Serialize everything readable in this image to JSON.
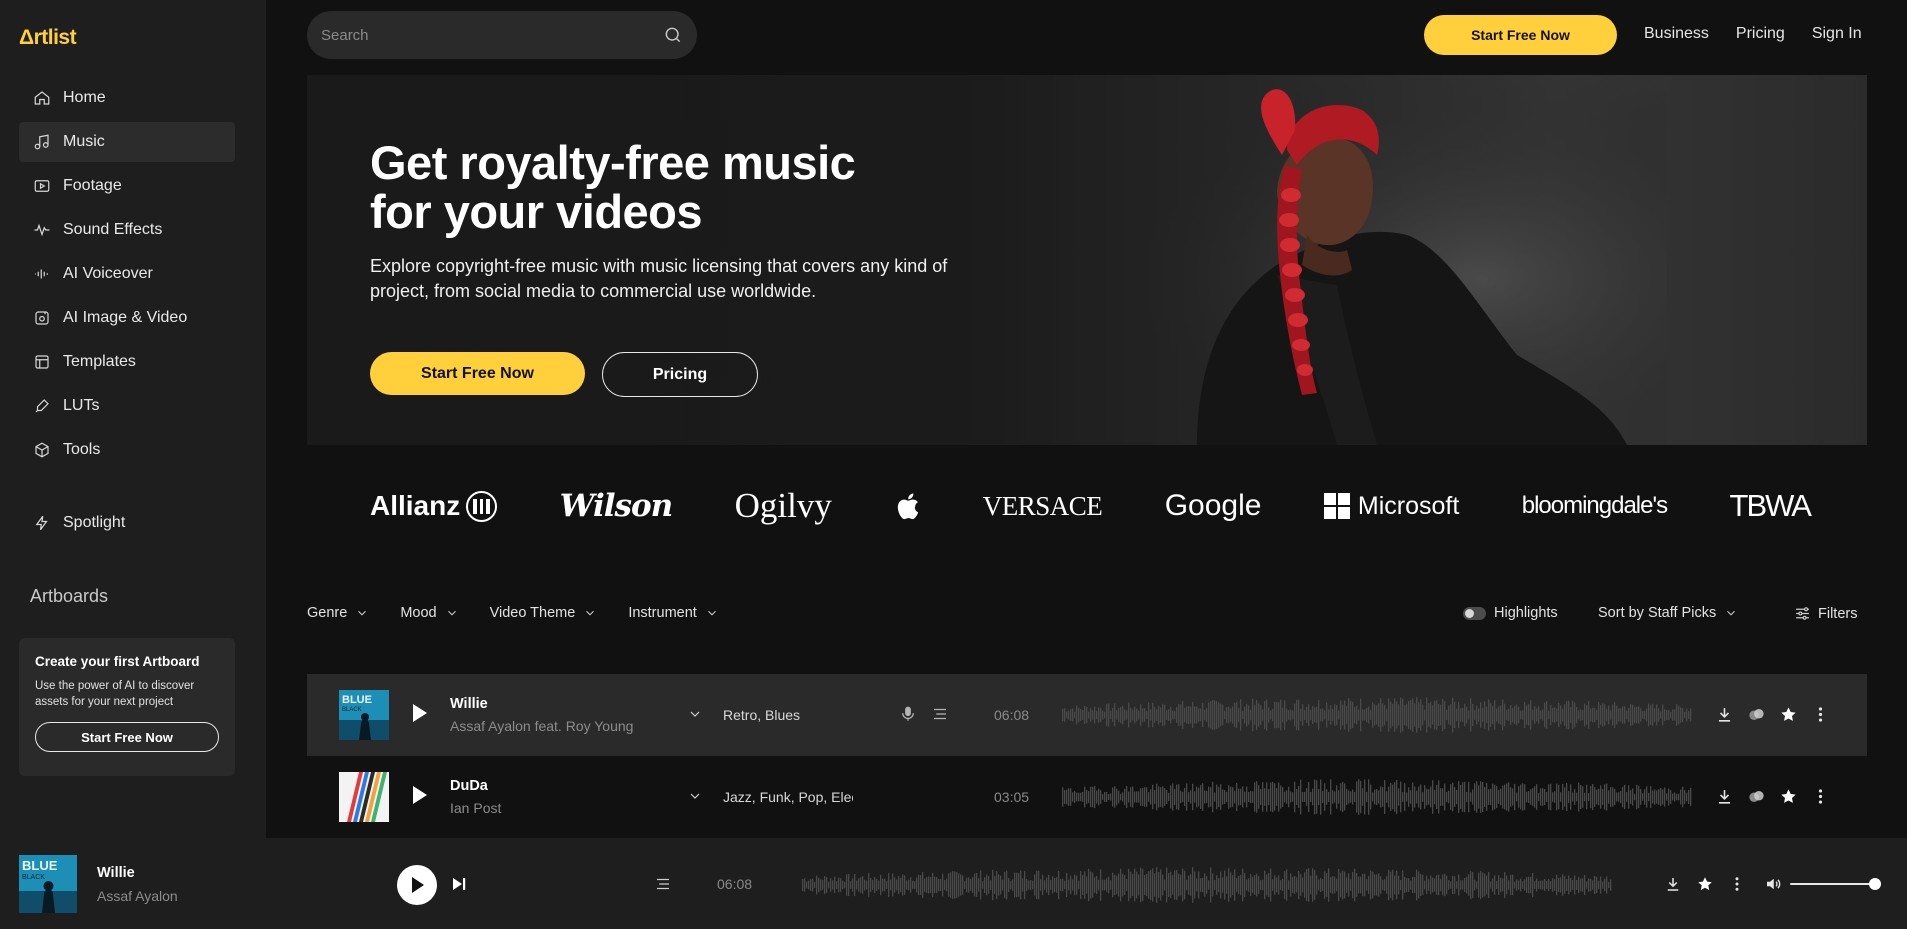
{
  "brand": {
    "logo": "Δrtlist",
    "accent": "#ffd03c"
  },
  "sidebar": {
    "items": [
      {
        "label": "Home",
        "icon": "home-icon"
      },
      {
        "label": "Music",
        "icon": "music-note-icon",
        "active": true
      },
      {
        "label": "Footage",
        "icon": "video-icon"
      },
      {
        "label": "Sound Effects",
        "icon": "waveform-icon"
      },
      {
        "label": "AI Voiceover",
        "icon": "voice-bars-icon"
      },
      {
        "label": "AI Image & Video",
        "icon": "ai-image-icon"
      },
      {
        "label": "Templates",
        "icon": "template-icon"
      },
      {
        "label": "LUTs",
        "icon": "dropper-icon"
      },
      {
        "label": "Tools",
        "icon": "cube-icon"
      }
    ],
    "spotlight": {
      "label": "Spotlight",
      "icon": "bolt-icon"
    },
    "artboards_title": "Artboards",
    "artboard_card": {
      "heading": "Create your first Artboard",
      "text": "Use the power of AI to discover assets for your next project",
      "button": "Start Free Now"
    }
  },
  "header": {
    "search_placeholder": "Search",
    "cta": "Start Free Now",
    "links": [
      "Business",
      "Pricing",
      "Sign In"
    ]
  },
  "hero": {
    "title_line1": "Get royalty-free music",
    "title_line2": "for your videos",
    "description": "Explore copyright-free music with music licensing that covers any kind of project, from social media to commercial use worldwide.",
    "cta_primary": "Start Free Now",
    "cta_secondary": "Pricing"
  },
  "brands": [
    "Allianz",
    "Wilson",
    "Ogilvy",
    "Apple",
    "VERSACE",
    "Google",
    "Microsoft",
    "bloomingdale's",
    "TBWA"
  ],
  "filters": {
    "items": [
      "Genre",
      "Mood",
      "Video Theme",
      "Instrument"
    ],
    "highlights": "Highlights",
    "sort": "Sort by Staff Picks",
    "filters": "Filters"
  },
  "tracks": [
    {
      "title": "Willie",
      "artist": "Assaf Ayalon feat. Roy Young",
      "tags": "Retro, Blues",
      "duration": "06:08"
    },
    {
      "title": "DuDa",
      "artist": "Ian Post",
      "tags": "Jazz, Funk, Pop, Elec",
      "duration": "03:05"
    }
  ],
  "player": {
    "title": "Willie",
    "artist": "Assaf Ayalon",
    "time": "06:08",
    "volume": 1.0
  }
}
